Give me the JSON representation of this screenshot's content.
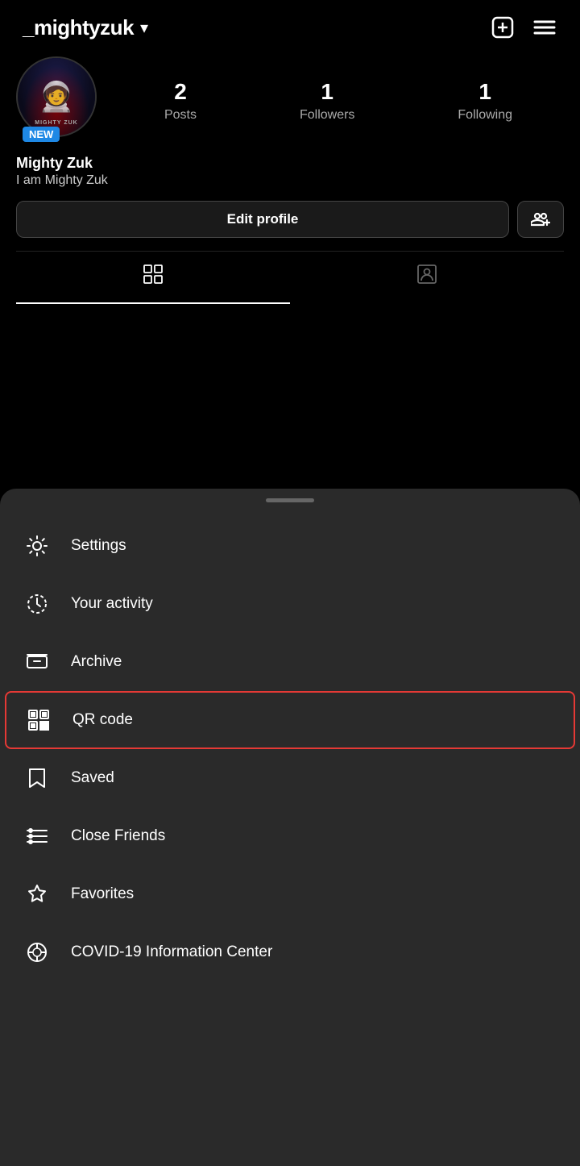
{
  "header": {
    "username": "_mightyzuk",
    "chevron": "▾",
    "add_icon": "⊕",
    "menu_icon": "≡"
  },
  "profile": {
    "avatar_alt": "Mighty Zuk profile photo",
    "badge_label": "NEW",
    "display_name": "Mighty Zuk",
    "bio": "I am Mighty Zuk",
    "stats": {
      "posts_count": "2",
      "posts_label": "Posts",
      "followers_count": "1",
      "followers_label": "Followers",
      "following_count": "1",
      "following_label": "Following"
    }
  },
  "buttons": {
    "edit_profile": "Edit profile"
  },
  "menu": {
    "handle_label": "drag handle",
    "items": [
      {
        "id": "settings",
        "label": "Settings",
        "icon": "settings-icon"
      },
      {
        "id": "your-activity",
        "label": "Your activity",
        "icon": "activity-icon"
      },
      {
        "id": "archive",
        "label": "Archive",
        "icon": "archive-icon"
      },
      {
        "id": "qr-code",
        "label": "QR code",
        "icon": "qr-icon",
        "highlighted": true
      },
      {
        "id": "saved",
        "label": "Saved",
        "icon": "saved-icon"
      },
      {
        "id": "close-friends",
        "label": "Close Friends",
        "icon": "close-friends-icon"
      },
      {
        "id": "favorites",
        "label": "Favorites",
        "icon": "favorites-icon"
      },
      {
        "id": "covid",
        "label": "COVID-19 Information Center",
        "icon": "covid-icon"
      }
    ]
  }
}
